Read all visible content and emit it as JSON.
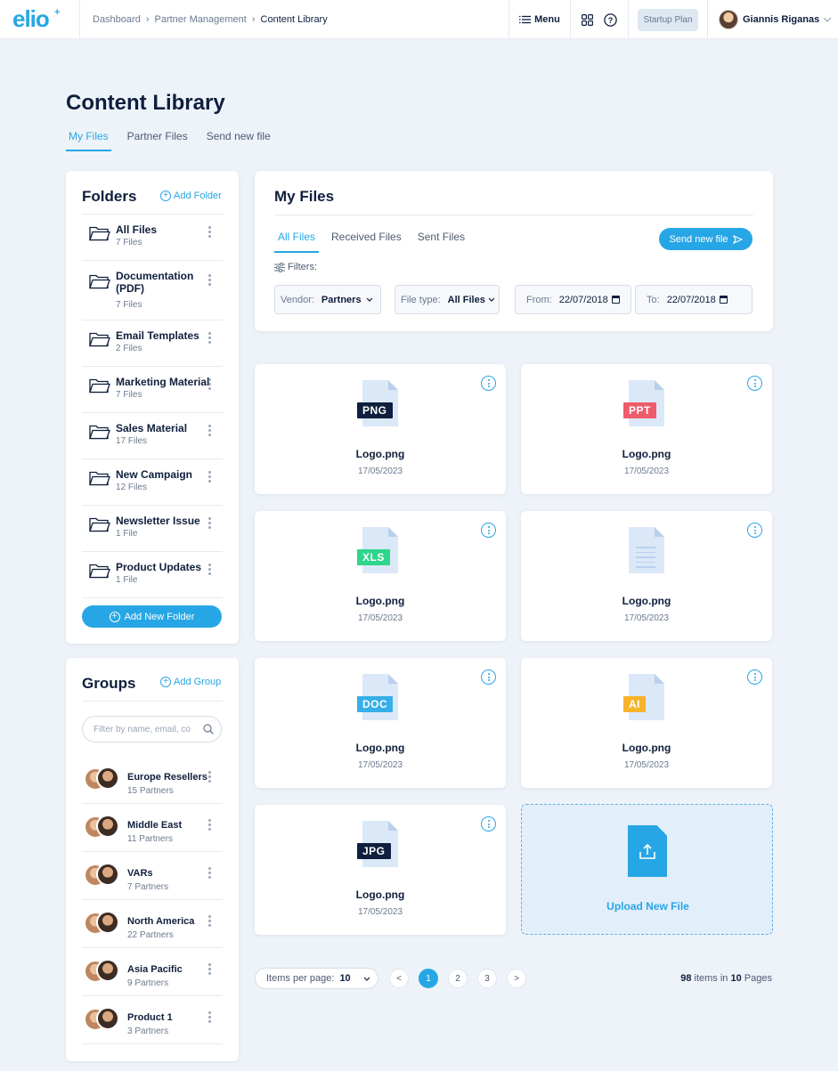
{
  "app": {
    "logo": "elio"
  },
  "breadcrumb": [
    "Dashboard",
    "Partner Management",
    "Content Library"
  ],
  "topbar": {
    "menu_label": "Menu",
    "plan_label": "Startup Plan",
    "user_name": "Giannis Riganas"
  },
  "page": {
    "title": "Content Library",
    "tabs": [
      "My Files",
      "Partner Files",
      "Send new file"
    ]
  },
  "folders": {
    "title": "Folders",
    "add_label": "Add Folder",
    "items": [
      {
        "name": "All Files",
        "count": "7 Files"
      },
      {
        "name": "Documentation (PDF)",
        "count": "7 Files"
      },
      {
        "name": "Email Templates",
        "count": "2 Files"
      },
      {
        "name": "Marketing Material",
        "count": "7 Files"
      },
      {
        "name": "Sales Material",
        "count": "17 Files"
      },
      {
        "name": "New Campaign",
        "count": "12 Files"
      },
      {
        "name": "Newsletter Issue",
        "count": "1 File"
      },
      {
        "name": "Product Updates",
        "count": "1 File"
      }
    ],
    "new_folder_label": "Add New Folder"
  },
  "groups": {
    "title": "Groups",
    "add_label": "Add Group",
    "search_placeholder": "Filter by name, email, co",
    "items": [
      {
        "name": "Europe Resellers",
        "count": "15 Partners"
      },
      {
        "name": "Middle East",
        "count": "11 Partners"
      },
      {
        "name": "VARs",
        "count": "7 Partners"
      },
      {
        "name": "North America",
        "count": "22 Partners"
      },
      {
        "name": "Asia Pacific",
        "count": "9 Partners"
      },
      {
        "name": "Product 1",
        "count": "3 Partners"
      }
    ]
  },
  "myfiles": {
    "title": "My Files",
    "tabs": [
      "All Files",
      "Received Files",
      "Sent Files"
    ],
    "send_button": "Send new file",
    "filters_label": "Filters:",
    "vendor_label": "Vendor:",
    "vendor_value": "Partners",
    "filetype_label": "File type:",
    "filetype_value": "All Files",
    "from_label": "From:",
    "from_value": "22/07/2018",
    "to_label": "To:",
    "to_value": "22/07/2018"
  },
  "files": [
    {
      "name": "Logo.png",
      "date": "17/05/2023",
      "type": "PNG",
      "color": "#0f1f3d"
    },
    {
      "name": "Logo.png",
      "date": "17/05/2023",
      "type": "PPT",
      "color": "#ef5b6b"
    },
    {
      "name": "Logo.png",
      "date": "17/05/2023",
      "type": "XLS",
      "color": "#2ed58a"
    },
    {
      "name": "Logo.png",
      "date": "17/05/2023",
      "type": "",
      "color": ""
    },
    {
      "name": "Logo.png",
      "date": "17/05/2023",
      "type": "DOC",
      "color": "#36aee8"
    },
    {
      "name": "Logo.png",
      "date": "17/05/2023",
      "type": "AI",
      "color": "#f7b32b"
    },
    {
      "name": "Logo.png",
      "date": "17/05/2023",
      "type": "JPG",
      "color": "#0f1f3d"
    }
  ],
  "upload": {
    "label": "Upload New File"
  },
  "pagination": {
    "per_page_label": "Items per page:",
    "per_page_value": "10",
    "prev": "<",
    "next": ">",
    "pages": [
      "1",
      "2",
      "3"
    ],
    "current": "1",
    "total_items": "98",
    "items_in": "items in",
    "total_pages": "10",
    "pages_word": "Pages"
  }
}
